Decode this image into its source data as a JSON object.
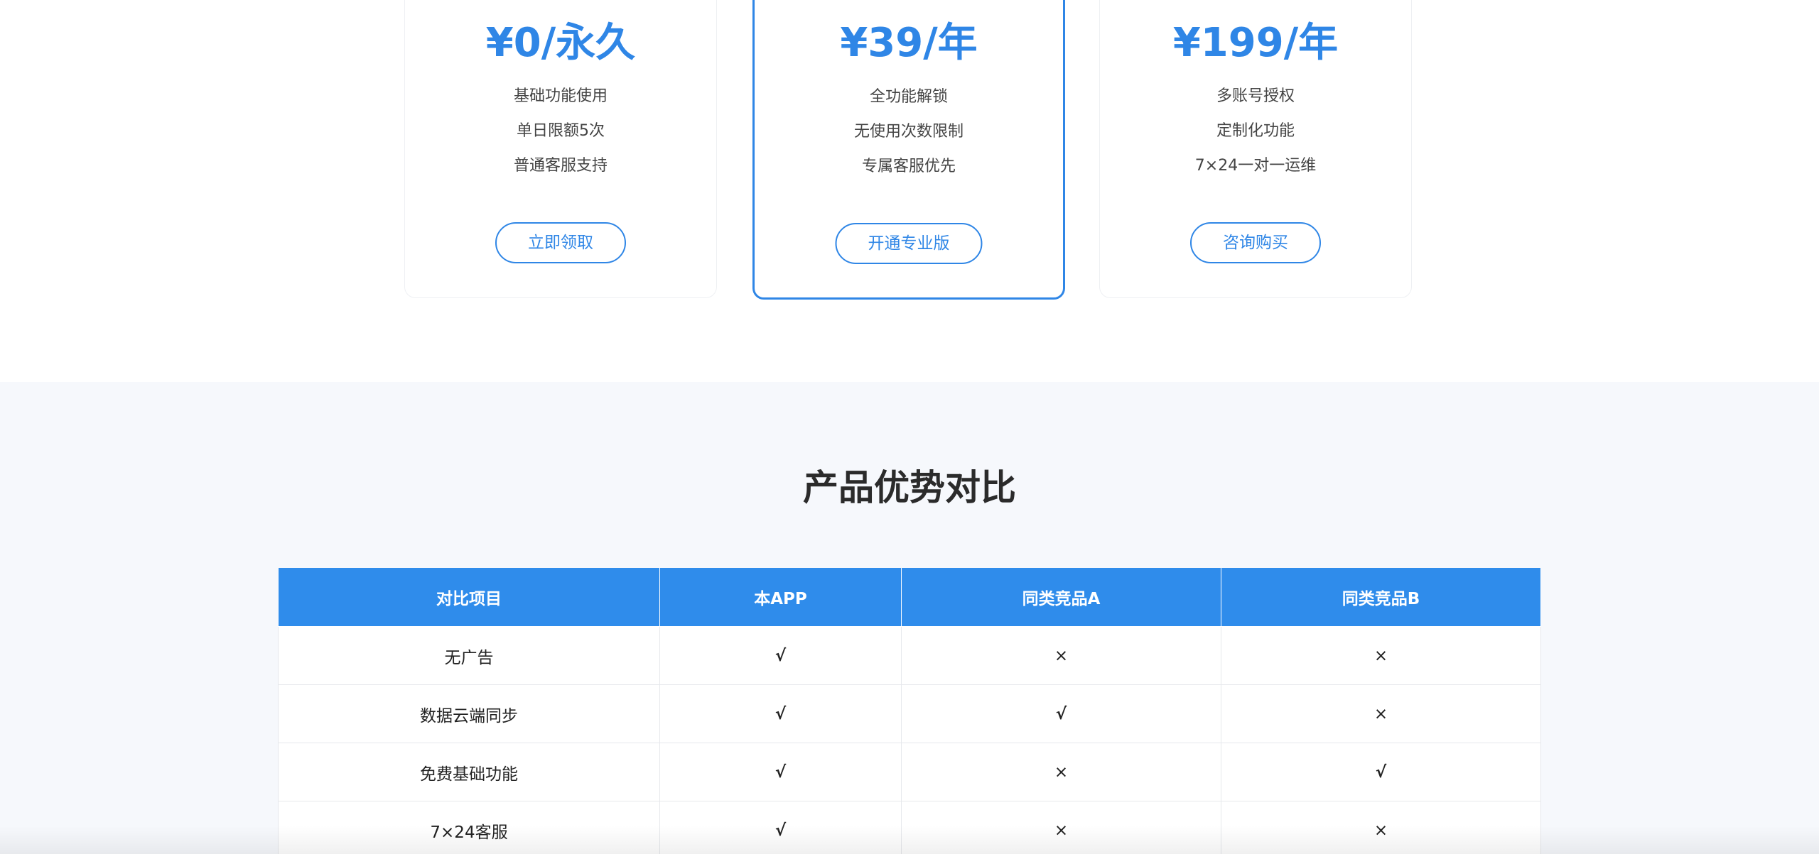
{
  "pricing": {
    "cards": [
      {
        "price": "¥0/永久",
        "features": [
          "基础功能使用",
          "单日限额5次",
          "普通客服支持"
        ],
        "button": "立即领取"
      },
      {
        "price": "¥39/年",
        "features": [
          "全功能解锁",
          "无使用次数限制",
          "专属客服优先"
        ],
        "button": "开通专业版"
      },
      {
        "price": "¥199/年",
        "features": [
          "多账号授权",
          "定制化功能",
          "7×24一对一运维"
        ],
        "button": "咨询购买"
      }
    ]
  },
  "compare": {
    "title": "产品优势对比",
    "headers": [
      "对比项目",
      "本APP",
      "同类竞品A",
      "同类竞品B"
    ],
    "rows": [
      [
        "无广告",
        "√",
        "×",
        "×"
      ],
      [
        "数据云端同步",
        "√",
        "√",
        "×"
      ],
      [
        "免费基础功能",
        "√",
        "×",
        "√"
      ],
      [
        "7×24客服",
        "√",
        "×",
        "×"
      ]
    ]
  },
  "colors": {
    "accent": "#2f86e6",
    "table_header": "#2f8ceb",
    "check": "#19b25f",
    "cross": "#ef5350"
  }
}
